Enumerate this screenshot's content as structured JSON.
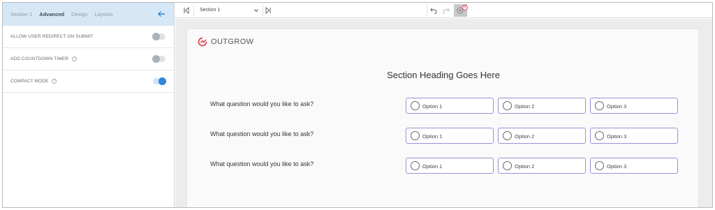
{
  "sidebar": {
    "tabs": [
      {
        "label": "Section 1",
        "active": false
      },
      {
        "label": "Advanced",
        "active": true
      },
      {
        "label": "Design",
        "active": false
      },
      {
        "label": "Layouts",
        "active": false
      }
    ],
    "settings": [
      {
        "label": "ALLOW USER REDIRECT ON SUBMIT",
        "info": false,
        "enabled": false
      },
      {
        "label": "ADD COUNTDOWN TIMER",
        "info": true,
        "enabled": false
      },
      {
        "label": "COMPACT MODE",
        "info": true,
        "enabled": true
      }
    ],
    "back_icon": "arrow-left-icon",
    "accent": "#2e86d6"
  },
  "toolbar": {
    "section_select_value": "Section 1",
    "preview_badge": "0",
    "icons": [
      "skip-back-icon",
      "skip-forward-icon",
      "undo-icon",
      "redo-icon",
      "eye-icon"
    ]
  },
  "canvas": {
    "logo_text": "OUTGROW",
    "heading": "Section Heading Goes Here",
    "questions": [
      {
        "text": "What question would you like to ask?",
        "options": [
          "Option 1",
          "Option 2",
          "Option 3"
        ]
      },
      {
        "text": "What question would you like to ask?",
        "options": [
          "Option 1",
          "Option 2",
          "Option 3"
        ]
      },
      {
        "text": "What question would you like to ask?",
        "options": [
          "Option 1",
          "Option 2",
          "Option 3"
        ]
      }
    ],
    "option_border_color": "#9b8fd6",
    "brand_color": "#e0464e"
  }
}
